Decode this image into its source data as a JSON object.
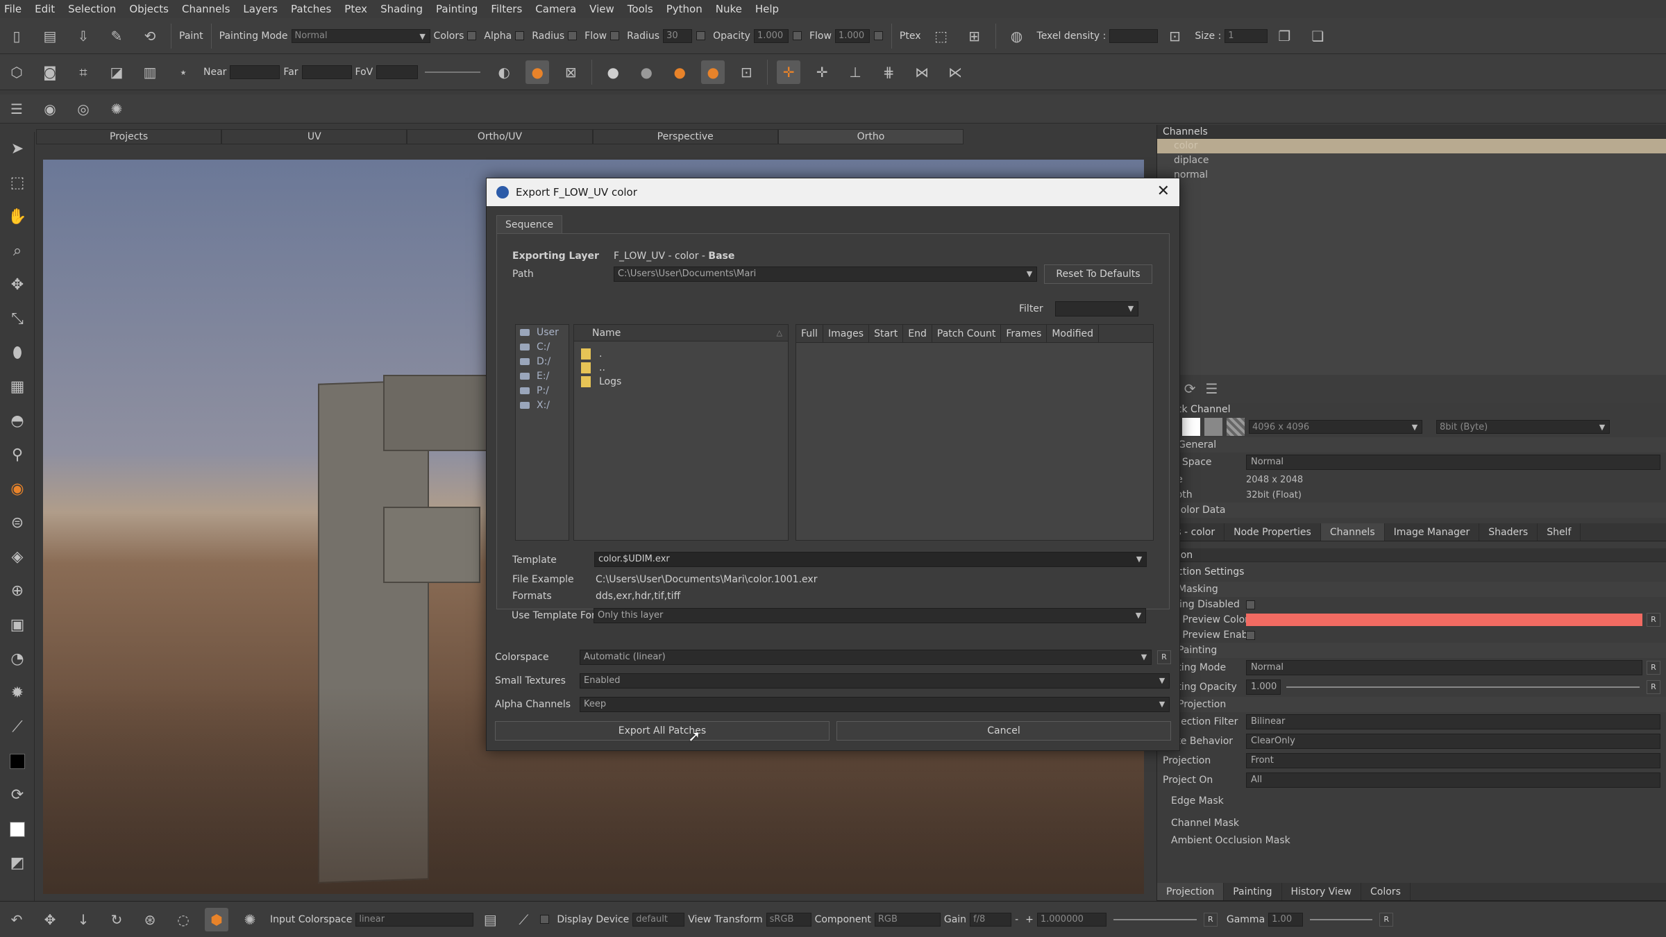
{
  "menu": [
    "File",
    "Edit",
    "Selection",
    "Objects",
    "Channels",
    "Layers",
    "Patches",
    "Ptex",
    "Shading",
    "Painting",
    "Filters",
    "Camera",
    "View",
    "Tools",
    "Python",
    "Nuke",
    "Help"
  ],
  "toolbar1": {
    "paint_label": "Paint",
    "painting_mode_label": "Painting Mode",
    "painting_mode_value": "Normal",
    "colors_label": "Colors",
    "alpha_label": "Alpha",
    "radius_check_label": "Radius",
    "flow_check_label": "Flow",
    "radius_label": "Radius",
    "radius_value": "30",
    "opacity_label": "Opacity",
    "opacity_value": "1.000",
    "flow_label": "Flow",
    "flow_value": "1.000",
    "ptex_label": "Ptex",
    "texel_label": "Texel density :",
    "texel_value": "",
    "size_label": "Size :",
    "size_value": "1"
  },
  "toolbar2": {
    "near_label": "Near",
    "far_label": "Far",
    "fov_label": "FoV"
  },
  "view_tabs": [
    "Projects",
    "UV",
    "Ortho/UV",
    "Perspective",
    "Ortho"
  ],
  "channels_panel": {
    "title": "Channels",
    "items": [
      "color",
      "diplace",
      "normal"
    ],
    "quick_channel_label": "Quick Channel",
    "resolution": "4096 x 4096",
    "depth_option": "8bit (Byte)",
    "general_label": "General",
    "file_space_label": "File Space",
    "file_space_value": "Normal",
    "size_label": "Size",
    "size_value": "2048 x 2048",
    "depth_label": "Depth",
    "depth_value": "32bit (Float)",
    "color_data_label": "Color Data"
  },
  "panel_tabs": [
    "ers - color",
    "Node Properties",
    "Channels",
    "Image Manager",
    "Shaders",
    "Shelf"
  ],
  "projection_panel": {
    "title": "ection",
    "settings_label": "ojection Settings",
    "masking_label": "Masking",
    "masking_disabled_label": "asking Disabled",
    "mask_preview_color_label": "ask Preview Color",
    "mask_preview_color": "#f26b62",
    "mask_preview_enabled_label": "ask Preview Enabled",
    "painting_label": "Painting",
    "painting_mode_label": "ainting Mode",
    "painting_mode_value": "Normal",
    "painting_opacity_label": "ainting Opacity",
    "painting_opacity_value": "1.000",
    "projection_label": "Projection",
    "projection_filter_label": "Projection Filter",
    "projection_filter_value": "Bilinear",
    "bake_behavior_label": "Bake Behavior",
    "bake_behavior_value": "ClearOnly",
    "projection_mode_label": "Projection",
    "projection_mode_value": "Front",
    "project_on_label": "Project On",
    "project_on_value": "All",
    "edge_mask_label": "Edge Mask",
    "channel_mask_label": "Channel Mask",
    "ao_mask_label": "Ambient Occlusion Mask"
  },
  "bottom_tabs": [
    "Projection",
    "Painting",
    "History View",
    "Colors"
  ],
  "statusbar": {
    "input_colorspace_label": "Input Colorspace",
    "input_colorspace_value": "linear",
    "display_device_label": "Display Device",
    "display_device_value": "default",
    "view_transform_label": "View Transform",
    "view_transform_value": "sRGB",
    "component_label": "Component",
    "component_value": "RGB",
    "gain_label": "Gain",
    "gain_value": "f/8",
    "gain_number": "1.000000",
    "gamma_label": "Gamma",
    "gamma_value": "1.00"
  },
  "dialog": {
    "title": "Export F_LOW_UV color",
    "tab": "Sequence",
    "exporting_layer_label": "Exporting Layer",
    "exporting_layer_value": "F_LOW_UV - color - ",
    "exporting_layer_bold": "Base",
    "path_label": "Path",
    "path_value": "C:\\Users\\User\\Documents\\Mari",
    "reset_button": "Reset To Defaults",
    "filter_label": "Filter",
    "drives": [
      "User",
      "C:/",
      "D:/",
      "E:/",
      "P:/",
      "X:/"
    ],
    "name_header": "Name",
    "files": [
      ".",
      "..",
      "Logs"
    ],
    "seq_headers": [
      "Full",
      "Images",
      "Start",
      "End",
      "Patch Count",
      "Frames",
      "Modified"
    ],
    "template_label": "Template",
    "template_value": "color.$UDIM.exr",
    "file_example_label": "File Example",
    "file_example_value": "C:\\Users\\User\\Documents\\Mari\\color.1001.exr",
    "formats_label": "Formats",
    "formats_value": "dds,exr,hdr,tif,tiff",
    "use_template_label": "Use Template For",
    "use_template_value": "Only this layer",
    "colorspace_label": "Colorspace",
    "colorspace_value": "Automatic (linear)",
    "small_textures_label": "Small Textures",
    "small_textures_value": "Enabled",
    "alpha_channels_label": "Alpha Channels",
    "alpha_channels_value": "Keep",
    "export_button": "Export All Patches",
    "cancel_button": "Cancel"
  }
}
